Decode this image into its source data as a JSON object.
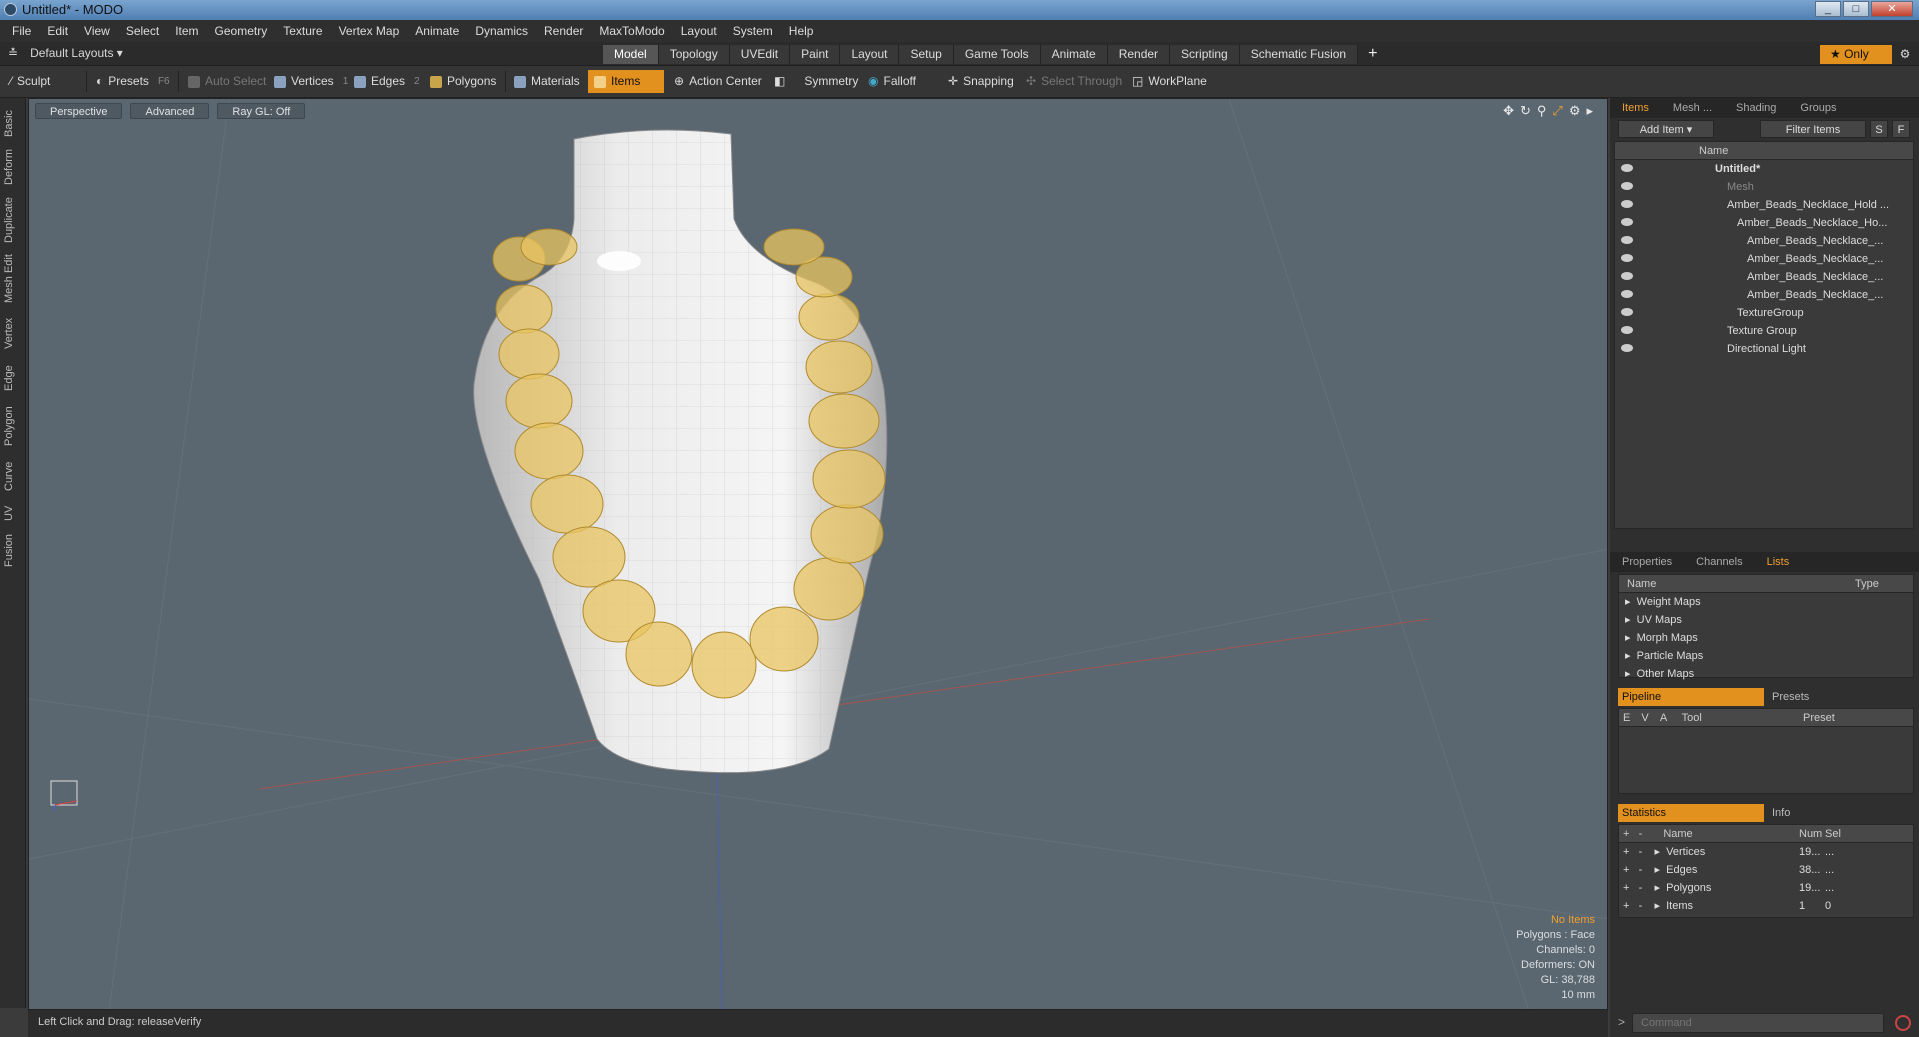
{
  "window": {
    "title": "Untitled* - MODO"
  },
  "menu": [
    "File",
    "Edit",
    "View",
    "Select",
    "Item",
    "Geometry",
    "Texture",
    "Vertex Map",
    "Animate",
    "Dynamics",
    "Render",
    "MaxToModo",
    "Layout",
    "System",
    "Help"
  ],
  "layout": {
    "name": "Default Layouts",
    "tabs": [
      "Model",
      "Topology",
      "UVEdit",
      "Paint",
      "Layout",
      "Setup",
      "Game Tools",
      "Animate",
      "Render",
      "Scripting",
      "Schematic Fusion"
    ],
    "active_tab": "Model",
    "only_label": "Only"
  },
  "toolbar": {
    "sculpt": "Sculpt",
    "presets": "Presets",
    "presets_key": "F6",
    "auto_select": "Auto Select",
    "vertices": "Vertices",
    "vertices_key": "1",
    "edges": "Edges",
    "edges_key": "2",
    "polygons": "Polygons",
    "materials": "Materials",
    "items": "Items",
    "action_center": "Action Center",
    "symmetry": "Symmetry",
    "falloff": "Falloff",
    "snapping": "Snapping",
    "select_through": "Select Through",
    "workplane": "WorkPlane"
  },
  "left_tabs": [
    "Basic",
    "Deform",
    "Duplicate",
    "Mesh Edit",
    "Vertex",
    "Edge",
    "Polygon",
    "Curve",
    "UV",
    "Fusion"
  ],
  "viewport": {
    "perspective": "Perspective",
    "advanced": "Advanced",
    "raygl": "Ray GL: Off",
    "stats": [
      "No Items",
      "Polygons : Face",
      "Channels: 0",
      "Deformers: ON",
      "GL: 38,788",
      "10 mm"
    ]
  },
  "status": {
    "text": "Left Click and Drag:   releaseVerify"
  },
  "items_panel": {
    "tabs": [
      "Items",
      "Mesh ...",
      "Shading",
      "Groups"
    ],
    "add_item": "Add Item",
    "filter_items": "Filter Items",
    "s": "S",
    "f": "F",
    "name_header": "Name",
    "tree": [
      {
        "label": "Untitled*",
        "indent": 0
      },
      {
        "label": "Mesh",
        "indent": 1
      },
      {
        "label": "Amber_Beads_Necklace_Hold ...",
        "indent": 1
      },
      {
        "label": "Amber_Beads_Necklace_Ho...",
        "indent": 2
      },
      {
        "label": "Amber_Beads_Necklace_...",
        "indent": 3
      },
      {
        "label": "Amber_Beads_Necklace_...",
        "indent": 3
      },
      {
        "label": "Amber_Beads_Necklace_...",
        "indent": 3
      },
      {
        "label": "Amber_Beads_Necklace_...",
        "indent": 3
      },
      {
        "label": "TextureGroup",
        "indent": 2
      },
      {
        "label": "Texture Group",
        "indent": 1
      },
      {
        "label": "Directional Light",
        "indent": 1
      }
    ]
  },
  "lists_panel": {
    "tabs": [
      "Properties",
      "Channels",
      "Lists"
    ],
    "name_header": "Name",
    "type_header": "Type",
    "items": [
      "Weight Maps",
      "UV Maps",
      "Morph Maps",
      "Particle Maps",
      "Other Maps"
    ]
  },
  "pipeline": {
    "tab_a": "Pipeline",
    "tab_b": "Presets",
    "cols": [
      "E",
      "V",
      "A",
      "Tool",
      "Preset"
    ]
  },
  "statistics": {
    "tab_a": "Statistics",
    "tab_b": "Info",
    "cols": [
      "Name",
      "Num",
      "Sel"
    ],
    "rows": [
      {
        "name": "Vertices",
        "num": "19...",
        "sel": "..."
      },
      {
        "name": "Edges",
        "num": "38...",
        "sel": "..."
      },
      {
        "name": "Polygons",
        "num": "19...",
        "sel": "..."
      },
      {
        "name": "Items",
        "num": "1",
        "sel": "0"
      }
    ]
  },
  "command": {
    "placeholder": "Command"
  }
}
